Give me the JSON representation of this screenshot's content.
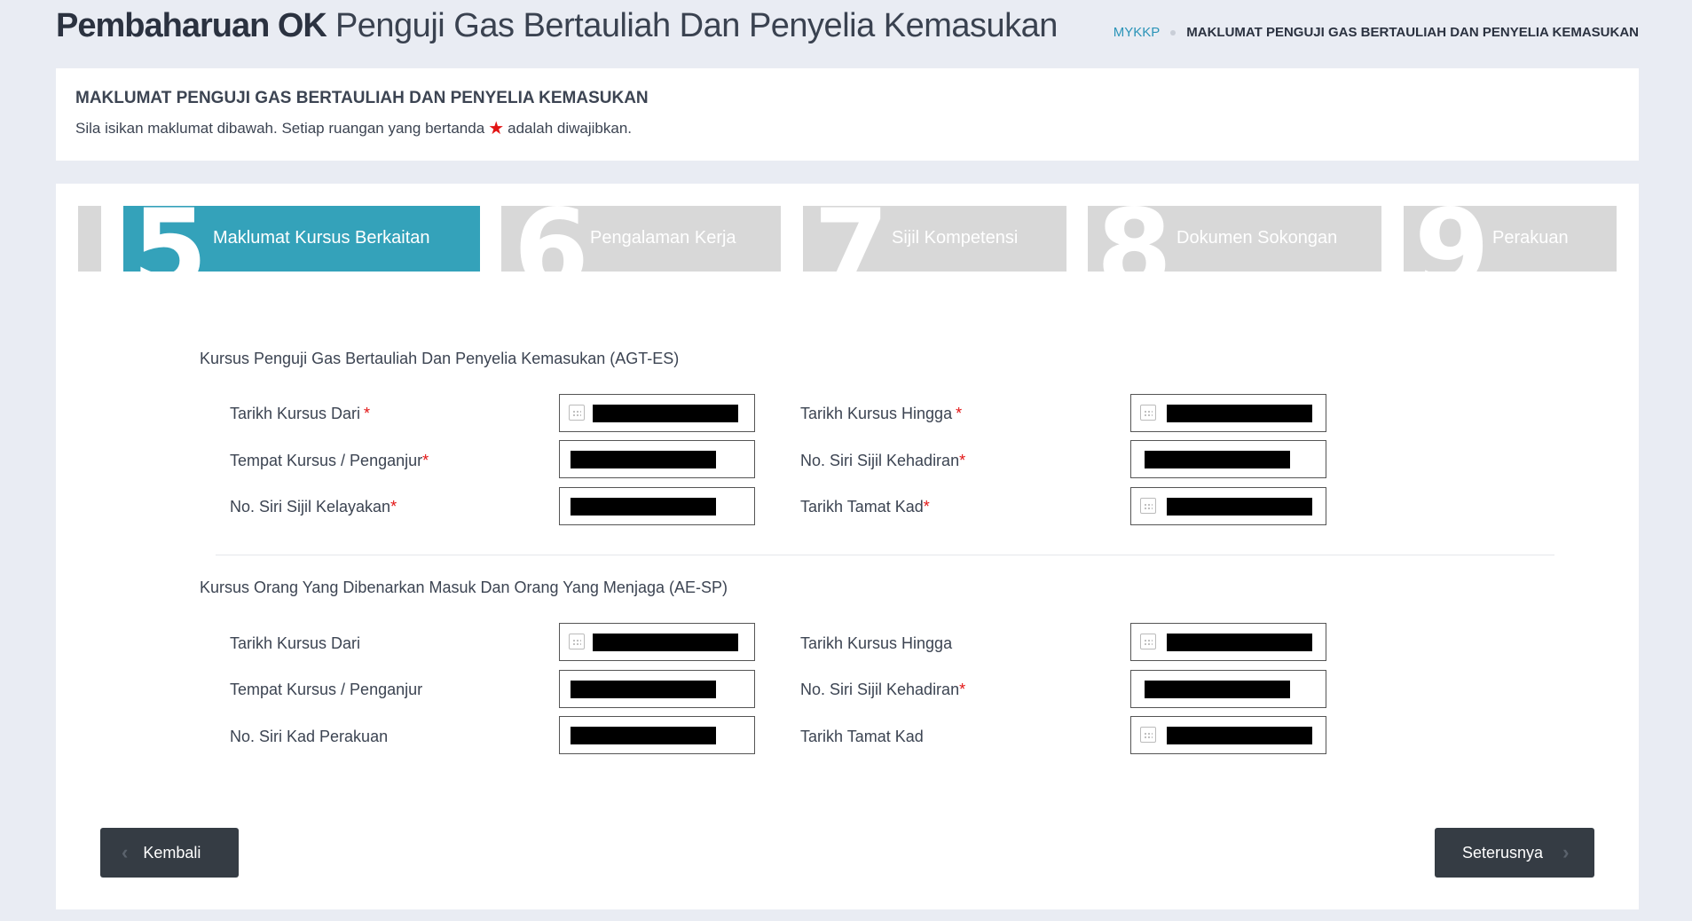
{
  "header": {
    "title_bold": "Pembaharuan OK",
    "title_light": "Penguji Gas Bertauliah Dan Penyelia Kemasukan"
  },
  "breadcrumb": {
    "home": "MYKKP",
    "current": "MAKLUMAT PENGUJI GAS BERTAULIAH DAN PENYELIA KEMASUKAN"
  },
  "info": {
    "title": "MAKLUMAT PENGUJI GAS BERTAULIAH DAN PENYELIA KEMASUKAN",
    "text_before": "Sila isikan maklumat dibawah. Setiap ruangan yang bertanda",
    "text_after": "adalah diwajibkan."
  },
  "steps": [
    {
      "number": "5",
      "label": "Maklumat Kursus Berkaitan",
      "active": true
    },
    {
      "number": "6",
      "label": "Pengalaman Kerja",
      "active": false
    },
    {
      "number": "7",
      "label": "Sijil Kompetensi",
      "active": false
    },
    {
      "number": "8",
      "label": "Dokumen Sokongan",
      "active": false
    },
    {
      "number": "9",
      "label": "Perakuan",
      "active": false
    }
  ],
  "section1": {
    "title": "Kursus Penguji Gas Bertauliah Dan Penyelia Kemasukan (AGT-ES)",
    "labels": {
      "tarikh_dari": "Tarikh Kursus Dari",
      "tempat": "Tempat Kursus / Penganjur",
      "no_siri_kelayakan": "No. Siri Sijil Kelayakan",
      "tarikh_hingga": "Tarikh Kursus Hingga",
      "no_siri_kehadiran": "No. Siri Sijil Kehadiran",
      "tarikh_tamat": "Tarikh Tamat Kad"
    }
  },
  "section2": {
    "title": "Kursus Orang Yang Dibenarkan Masuk Dan Orang Yang Menjaga (AE-SP)",
    "labels": {
      "tarikh_dari": "Tarikh Kursus Dari",
      "tempat": "Tempat Kursus / Penganjur",
      "no_siri_kad": "No. Siri Kad Perakuan",
      "tarikh_hingga": "Tarikh Kursus Hingga",
      "no_siri_kehadiran": "No. Siri Sijil Kehadiran",
      "tarikh_tamat": "Tarikh Tamat Kad"
    }
  },
  "required_mark": "*",
  "buttons": {
    "back": "Kembali",
    "next": "Seterusnya"
  },
  "colors": {
    "accent": "#34a2ba",
    "required": "#e21414",
    "button_bg": "#353c44"
  }
}
